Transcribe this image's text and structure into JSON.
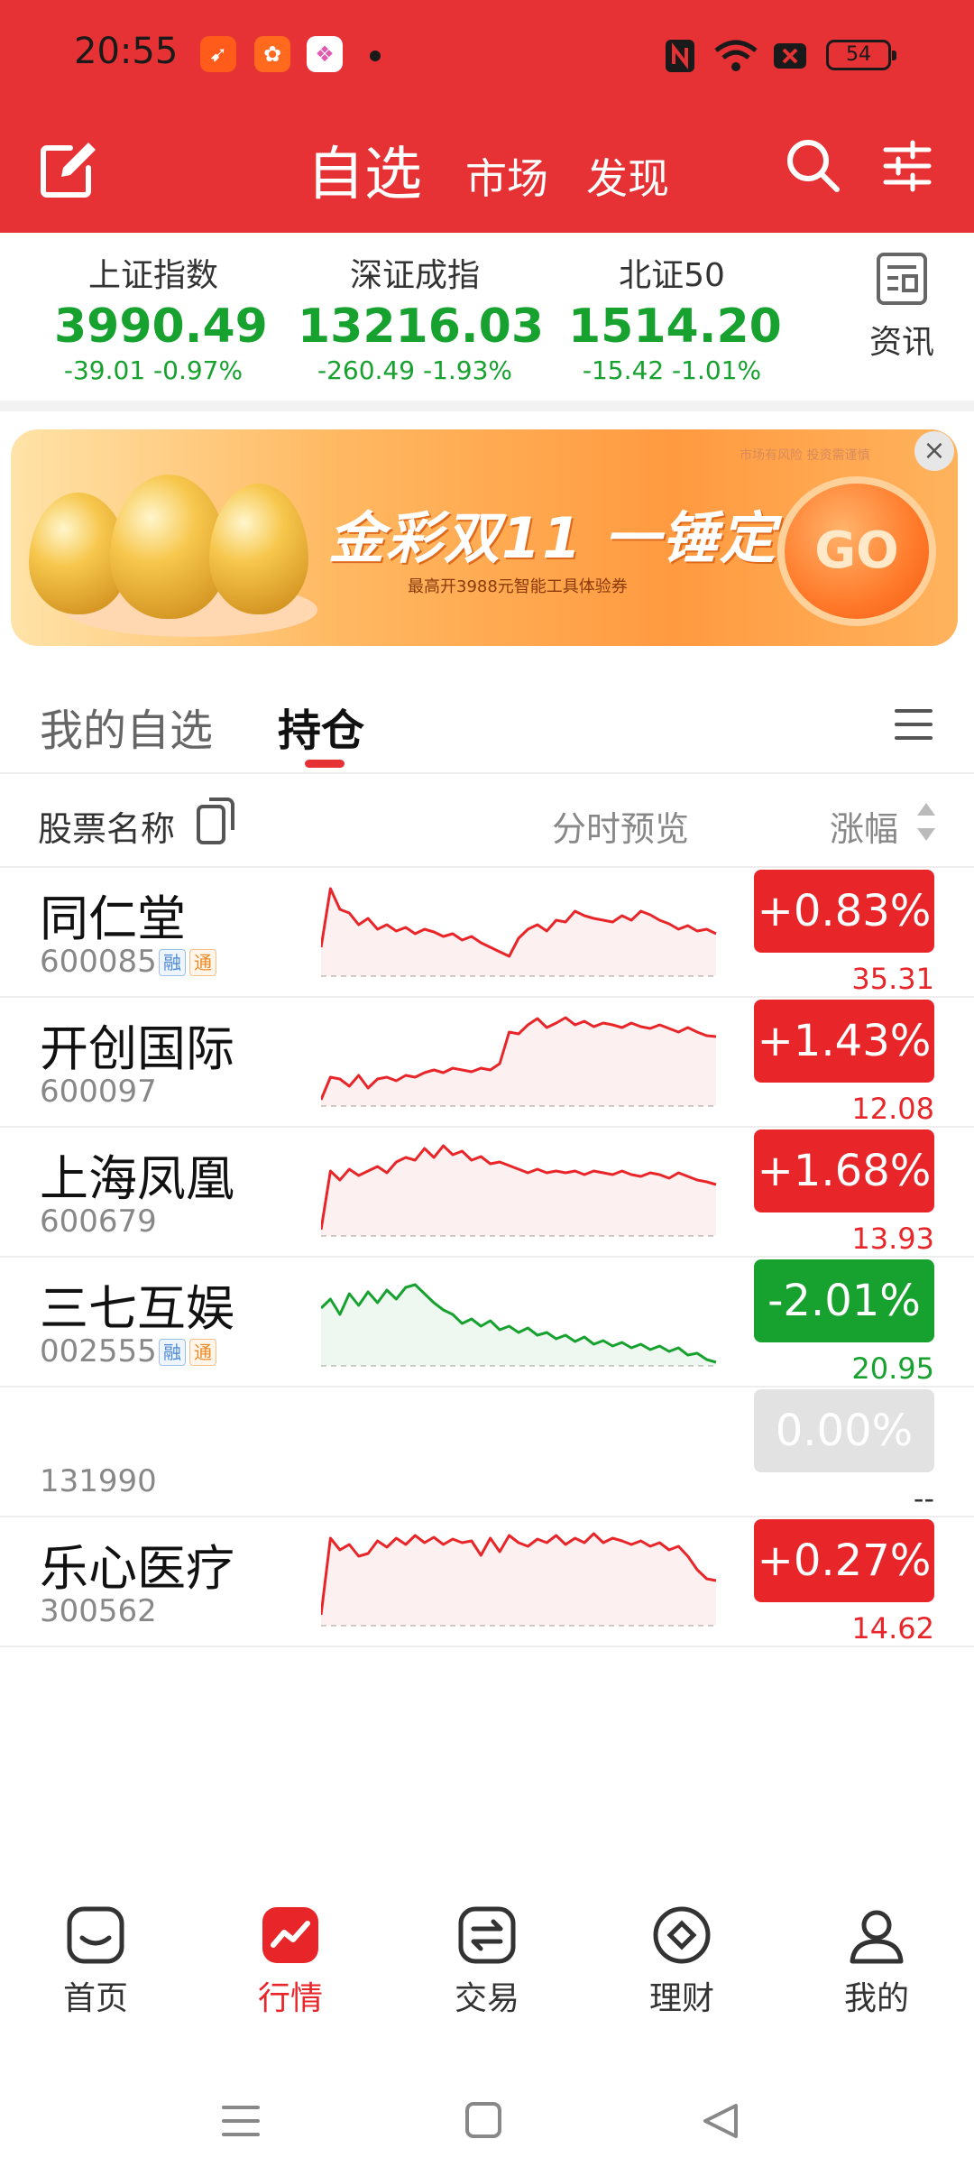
{
  "status_bar": {
    "time": "20:55",
    "battery": "54",
    "icons": [
      "app-orange-icon",
      "app-multi-icon",
      "app-gallery-icon",
      "nfc-icon",
      "wifi-icon",
      "sim-x-icon",
      "battery-icon"
    ]
  },
  "nav": {
    "tab_active": "自选",
    "tab_market": "市场",
    "tab_discover": "发现"
  },
  "indices": [
    {
      "name": "上证指数",
      "value": "3990.49",
      "change": "-39.01  -0.97%"
    },
    {
      "name": "深证成指",
      "value": "13216.03",
      "change": "-260.49  -1.93%"
    },
    {
      "name": "北证50",
      "value": "1514.20",
      "change": "-15.42  -1.01%"
    }
  ],
  "news_label": "资讯",
  "banner": {
    "title": "金彩双11 一锤定财",
    "subtitle": "最高开3988元智能工具体验券",
    "risk_note": "市场有风险 投资需谨慎",
    "cta": "GO"
  },
  "list_tabs": {
    "watchlist": "我的自选",
    "holdings": "持仓"
  },
  "columns": {
    "name": "股票名称",
    "preview": "分时预览",
    "change": "涨幅"
  },
  "colors": {
    "up": "#e8262a",
    "down": "#17a22f",
    "flat": "#e2e2e2",
    "header": "#e63234"
  },
  "stocks": [
    {
      "name": "同仁堂",
      "code": "600085",
      "tags": [
        "融",
        "通"
      ],
      "change": "+0.83%",
      "price": "35.31",
      "trend": "up",
      "series": [
        0.3,
        0.95,
        0.72,
        0.68,
        0.55,
        0.62,
        0.5,
        0.55,
        0.48,
        0.52,
        0.45,
        0.5,
        0.47,
        0.42,
        0.45,
        0.38,
        0.42,
        0.35,
        0.3,
        0.25,
        0.2,
        0.4,
        0.5,
        0.55,
        0.48,
        0.6,
        0.58,
        0.7,
        0.65,
        0.62,
        0.6,
        0.58,
        0.65,
        0.6,
        0.7,
        0.66,
        0.6,
        0.56,
        0.5,
        0.54,
        0.48,
        0.5,
        0.45
      ]
    },
    {
      "name": "开创国际",
      "code": "600097",
      "tags": [],
      "change": "+1.43%",
      "price": "12.08",
      "trend": "up",
      "series": [
        0.05,
        0.3,
        0.28,
        0.2,
        0.32,
        0.18,
        0.28,
        0.3,
        0.26,
        0.32,
        0.3,
        0.35,
        0.38,
        0.35,
        0.4,
        0.38,
        0.36,
        0.4,
        0.38,
        0.45,
        0.8,
        0.78,
        0.88,
        0.95,
        0.85,
        0.9,
        0.96,
        0.88,
        0.92,
        0.86,
        0.9,
        0.88,
        0.85,
        0.9,
        0.86,
        0.84,
        0.88,
        0.84,
        0.8,
        0.85,
        0.8,
        0.76,
        0.75
      ]
    },
    {
      "name": "上海凤凰",
      "code": "600679",
      "tags": [],
      "change": "+1.68%",
      "price": "13.93",
      "trend": "up",
      "series": [
        0.05,
        0.7,
        0.6,
        0.72,
        0.65,
        0.7,
        0.75,
        0.68,
        0.8,
        0.85,
        0.82,
        0.95,
        0.85,
        0.98,
        0.88,
        0.92,
        0.82,
        0.86,
        0.78,
        0.8,
        0.76,
        0.72,
        0.68,
        0.72,
        0.68,
        0.7,
        0.68,
        0.7,
        0.66,
        0.7,
        0.68,
        0.66,
        0.7,
        0.66,
        0.64,
        0.68,
        0.66,
        0.62,
        0.68,
        0.64,
        0.6,
        0.58,
        0.55
      ]
    },
    {
      "name": "三七互娱",
      "code": "002555",
      "tags": [
        "融",
        "通"
      ],
      "change": "-2.01%",
      "price": "20.95",
      "trend": "down",
      "series": [
        0.62,
        0.72,
        0.55,
        0.78,
        0.65,
        0.8,
        0.68,
        0.82,
        0.72,
        0.85,
        0.88,
        0.78,
        0.68,
        0.6,
        0.55,
        0.45,
        0.5,
        0.42,
        0.48,
        0.38,
        0.42,
        0.35,
        0.4,
        0.32,
        0.35,
        0.28,
        0.32,
        0.25,
        0.3,
        0.22,
        0.26,
        0.2,
        0.24,
        0.18,
        0.22,
        0.16,
        0.2,
        0.14,
        0.18,
        0.1,
        0.12,
        0.05,
        0.02
      ]
    },
    {
      "name": "",
      "code": "131990",
      "tags": [],
      "change": "0.00%",
      "price": "--",
      "trend": "flat",
      "series": []
    },
    {
      "name": "乐心医疗",
      "code": "300562",
      "tags": [],
      "change": "+0.27%",
      "price": "14.62",
      "trend": "up",
      "series": [
        0.1,
        0.95,
        0.82,
        0.88,
        0.75,
        0.78,
        0.92,
        0.85,
        0.95,
        0.88,
        0.98,
        0.9,
        0.96,
        0.88,
        0.94,
        0.9,
        0.92,
        0.76,
        0.95,
        0.8,
        0.98,
        0.9,
        0.86,
        0.94,
        0.9,
        0.98,
        0.88,
        0.95,
        0.9,
        1.0,
        0.9,
        0.95,
        0.92,
        0.88,
        0.92,
        0.86,
        0.9,
        0.82,
        0.86,
        0.75,
        0.6,
        0.5,
        0.48
      ]
    }
  ],
  "bottom_nav": [
    {
      "label": "首页",
      "icon": "home-icon",
      "active": false
    },
    {
      "label": "行情",
      "icon": "market-icon",
      "active": true
    },
    {
      "label": "交易",
      "icon": "trade-icon",
      "active": false
    },
    {
      "label": "理财",
      "icon": "wealth-icon",
      "active": false
    },
    {
      "label": "我的",
      "icon": "profile-icon",
      "active": false
    }
  ]
}
